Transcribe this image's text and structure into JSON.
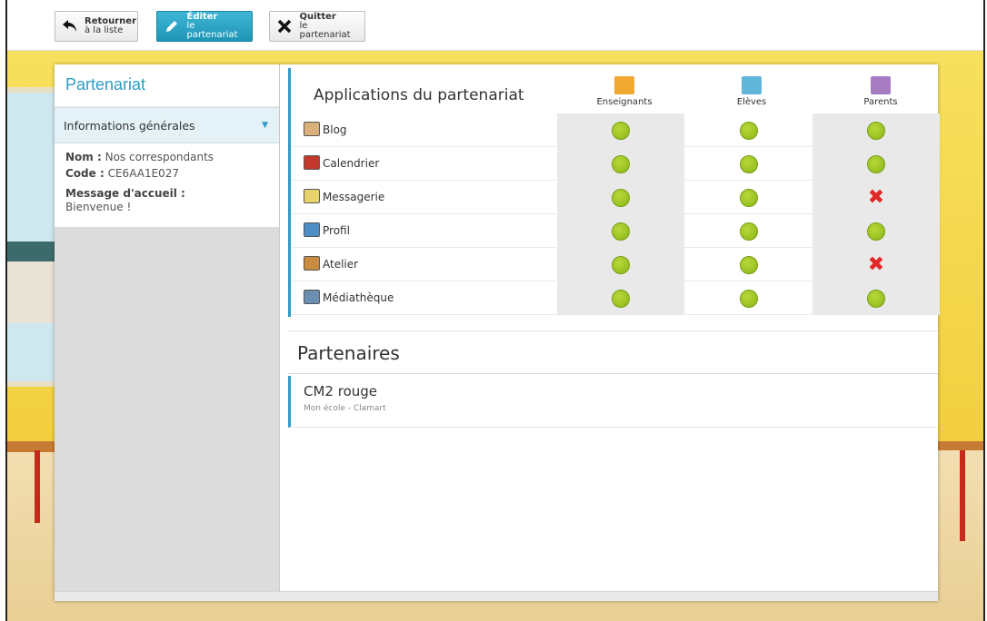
{
  "toolbar": {
    "back": {
      "line1": "Retourner",
      "line2": "à la liste"
    },
    "edit": {
      "line1": "Éditer",
      "line2": "le partenariat"
    },
    "quit": {
      "line1": "Quitter",
      "line2": "le partenariat"
    }
  },
  "sidebar": {
    "title": "Partenariat",
    "section": "Informations générales",
    "nom_label": "Nom :",
    "nom_value": "Nos correspondants",
    "code_label": "Code :",
    "code_value": "CE6AA1E027",
    "message_label": "Message d'accueil :",
    "message_value": "Bienvenue !"
  },
  "apps": {
    "title": "Applications du partenariat",
    "columns": [
      {
        "label": "Enseignants",
        "icon": "teacher-icon",
        "color": "#f0a830"
      },
      {
        "label": "Elèves",
        "icon": "student-icon",
        "color": "#5fb6d9"
      },
      {
        "label": "Parents",
        "icon": "parents-icon",
        "color": "#a77bc2"
      }
    ],
    "rows": [
      {
        "name": "Blog",
        "icon": "blog-icon",
        "access": [
          "yes",
          "yes",
          "yes"
        ]
      },
      {
        "name": "Calendrier",
        "icon": "calendar-icon",
        "access": [
          "yes",
          "yes",
          "yes"
        ]
      },
      {
        "name": "Messagerie",
        "icon": "mail-icon",
        "access": [
          "yes",
          "yes",
          "no"
        ]
      },
      {
        "name": "Profil",
        "icon": "profile-icon",
        "access": [
          "yes",
          "yes",
          "yes"
        ]
      },
      {
        "name": "Atelier",
        "icon": "workshop-icon",
        "access": [
          "yes",
          "yes",
          "no"
        ]
      },
      {
        "name": "Médiathèque",
        "icon": "media-library-icon",
        "access": [
          "yes",
          "yes",
          "yes"
        ]
      }
    ]
  },
  "partners": {
    "title": "Partenaires",
    "items": [
      {
        "name": "CM2 rouge",
        "school": "Mon école - Clamart"
      }
    ]
  },
  "colors": {
    "accent": "#2e9cc4",
    "ok": "#9bc61f",
    "no": "#e12727"
  }
}
